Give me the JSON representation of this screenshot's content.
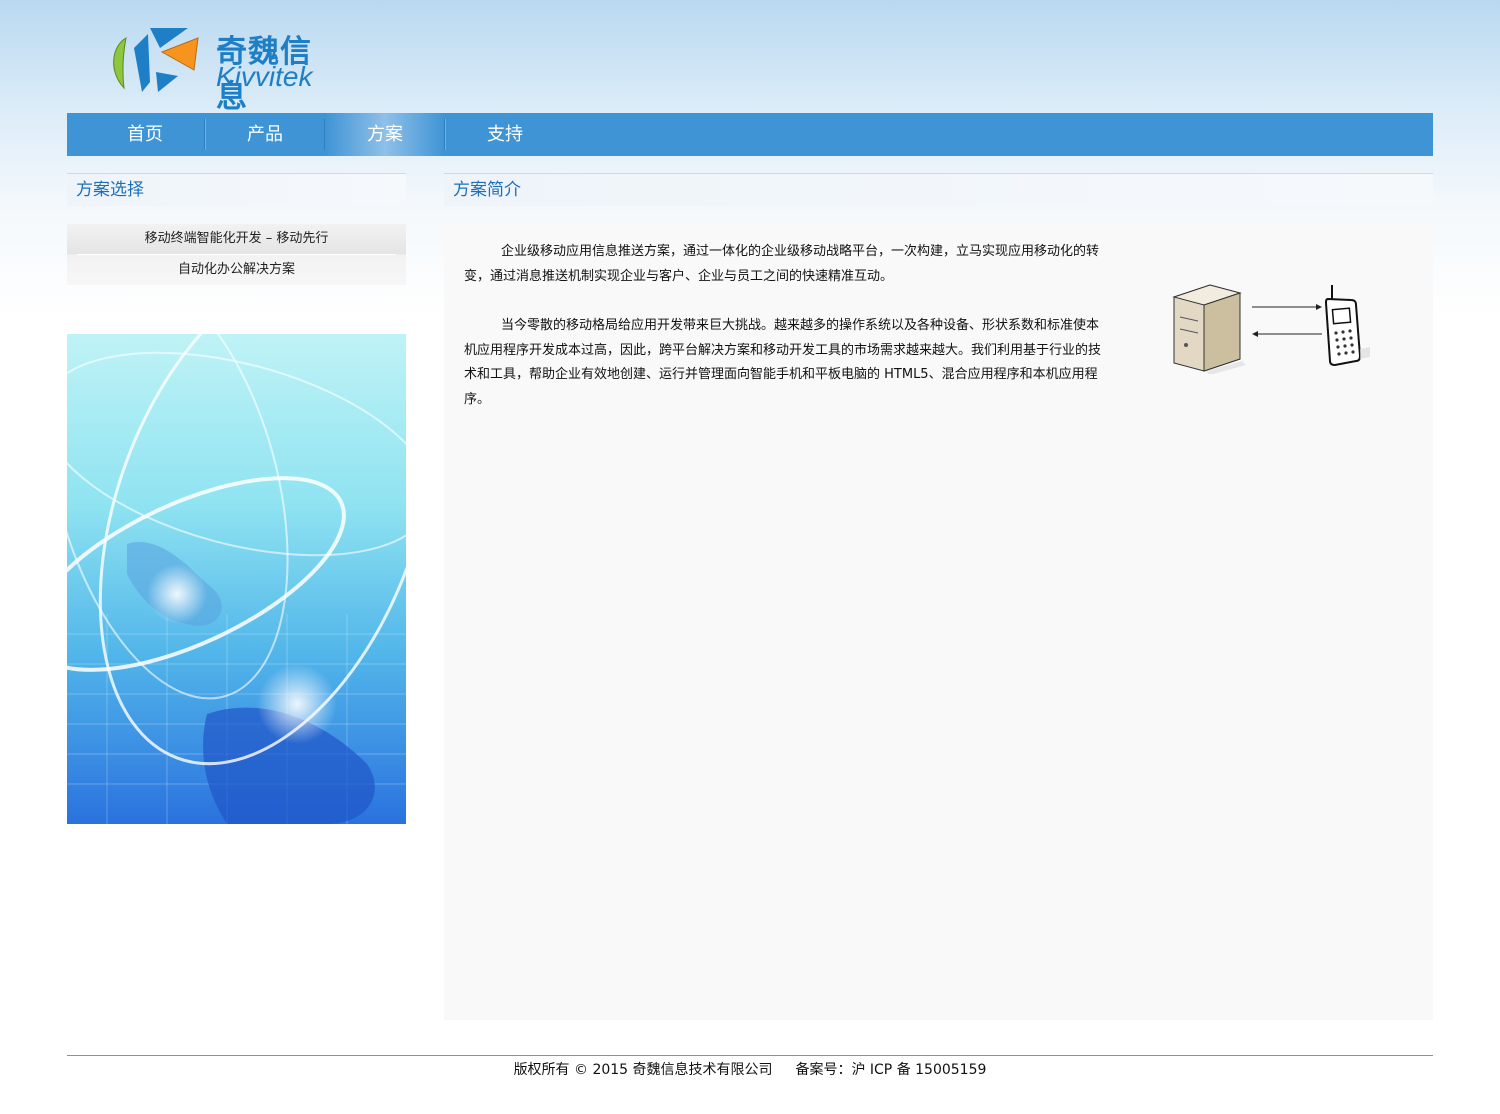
{
  "brand": {
    "name_cn": "奇魏信息",
    "name_en": "Kivvitek",
    "colors": {
      "green": "#8dc63f",
      "blue": "#1e7fc6",
      "orange": "#f7941d"
    }
  },
  "nav": {
    "items": [
      {
        "label": "首页",
        "active": false
      },
      {
        "label": "产品",
        "active": false
      },
      {
        "label": "方案",
        "active": true
      },
      {
        "label": "支持",
        "active": false
      }
    ]
  },
  "sidebar": {
    "title": "方案选择",
    "items": [
      {
        "label": "移动终端智能化开发 – 移动先行"
      },
      {
        "label": "自动化办公解决方案"
      }
    ]
  },
  "main": {
    "title": "方案简介",
    "paragraphs": [
      "企业级移动应用信息推送方案，通过一体化的企业级移动战略平台，一次构建，立马实现应用移动化的转变，通过消息推送机制实现企业与客户、企业与员工之间的快速精准互动。",
      "当今零散的移动格局给应用开发带来巨大挑战。越来越多的操作系统以及各种设备、形状系数和标准使本机应用程序开发成本过高，因此，跨平台解决方案和移动开发工具的市场需求越来越大。我们利用基于行业的技术和工具，帮助企业有效地创建、运行并管理面向智能手机和平板电脑的 HTML5、混合应用程序和本机应用程序。"
    ]
  },
  "footer": {
    "copyright": "版权所有 © 2015 奇魏信息技术有限公司",
    "icp": "备案号：沪 ICP 备 15005159"
  }
}
